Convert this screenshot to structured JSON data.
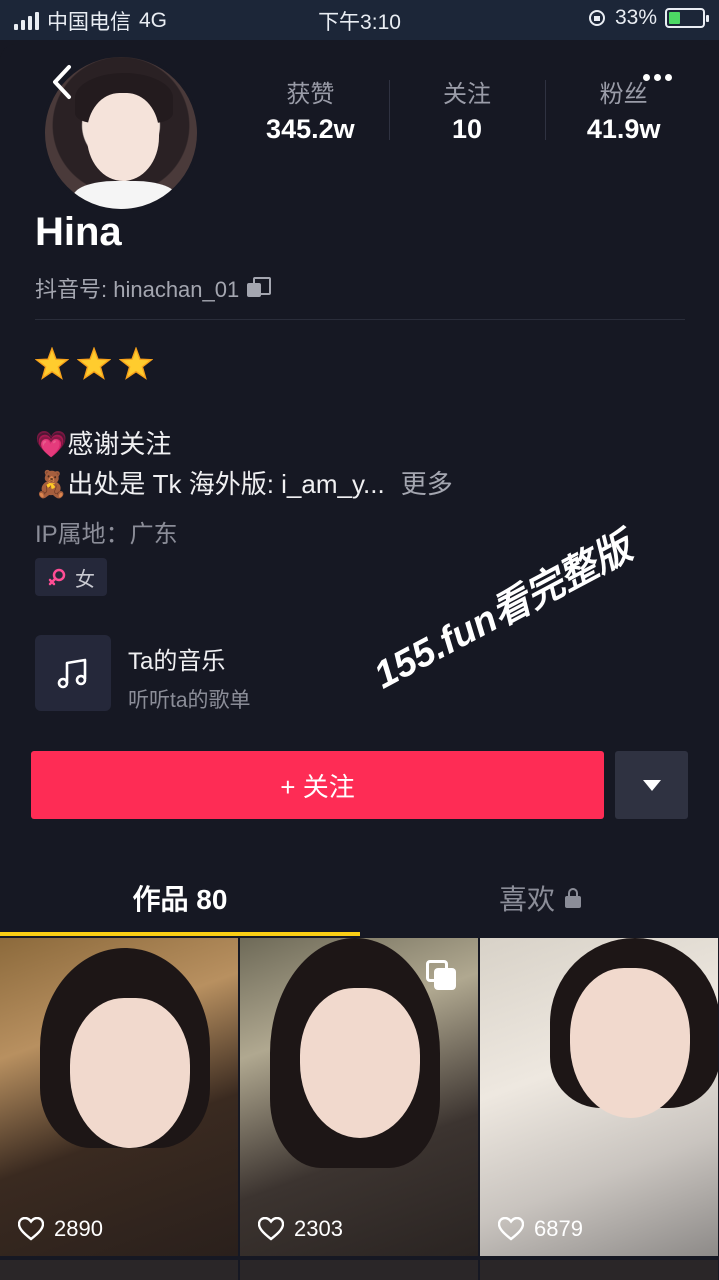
{
  "status_bar": {
    "carrier": "中国电信",
    "network": "4G",
    "time": "下午3:10",
    "battery": "33%",
    "battery_level": 0.33
  },
  "profile": {
    "name": "Hina",
    "douyin_id": "抖音号: hinachan_01",
    "stats": [
      {
        "label": "获赞",
        "value": "345.2w"
      },
      {
        "label": "关注",
        "value": "10"
      },
      {
        "label": "粉丝",
        "value": "41.9w"
      }
    ],
    "bio": {
      "line1": "💗感谢关注",
      "line2": "🧸出处是 Tk 海外版: i_am_y...",
      "more": "更多"
    },
    "ip": "IP属地：广东",
    "gender": "女"
  },
  "music": {
    "title": "Ta的音乐",
    "subtitle": "听听ta的歌单"
  },
  "watermark": "155.fun看完整版",
  "actions": {
    "follow_label": "+ 关注"
  },
  "tabs": [
    {
      "label": "作品 80"
    },
    {
      "label": "喜欢"
    }
  ],
  "videos": [
    {
      "likes": "2890"
    },
    {
      "likes": "2303"
    },
    {
      "likes": "6879"
    }
  ],
  "colors": {
    "background": "#161823",
    "follow_button": "#fe2c55",
    "tab_indicator": "#face15"
  }
}
